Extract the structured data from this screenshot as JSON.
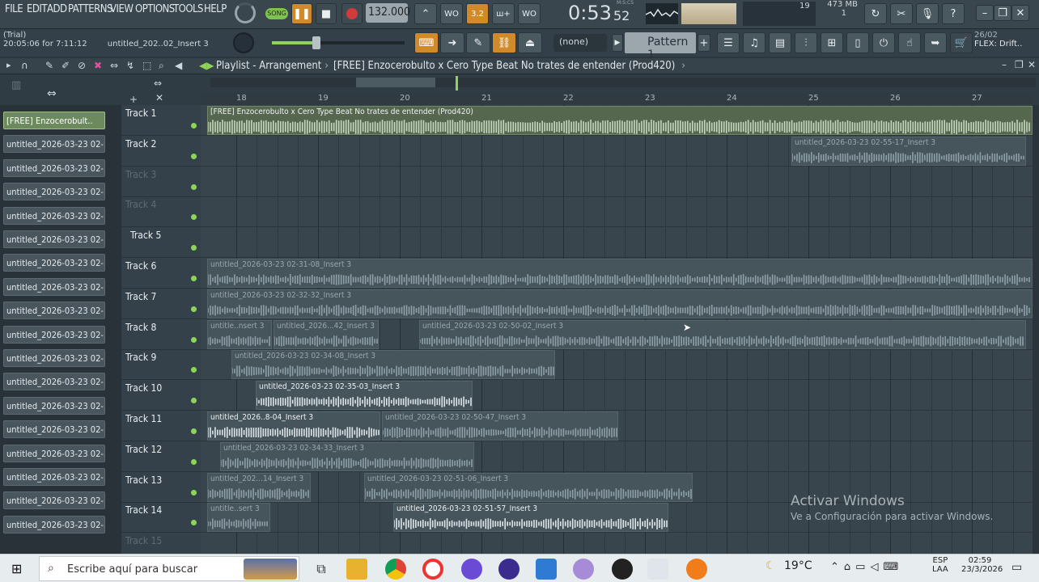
{
  "menu": [
    "FILE",
    "EDIT",
    "ADD",
    "PATTERNS",
    "VIEW",
    "OPTIONS",
    "TOOLS",
    "HELP"
  ],
  "transport": {
    "mode": "SONG",
    "tempo": "132.000",
    "time": "0:53",
    "time_sub": "52",
    "time_unit": "M:S:CS",
    "cpu": "19",
    "memory": "473 MB",
    "voices": "1"
  },
  "info": {
    "status": "(Trial)",
    "trial_time": "20:05:06 for 7:11:12",
    "hint": "untitled_202..02_Insert 3",
    "snap": "(none)",
    "pattern": "Pattern 1",
    "news_date": "26/02",
    "news_text": "FLEX: Drift.."
  },
  "playlist": {
    "breadcrumb": "Playlist - Arrangement",
    "separator": "›",
    "project": "[FREE] Enzocerobulto x Cero  Type Beat  No trates de entender  (Prod420)"
  },
  "ruler": [
    "18",
    "19",
    "20",
    "21",
    "22",
    "23",
    "24",
    "25",
    "26",
    "27"
  ],
  "patterns": [
    "[FREE] Enzocerobult..",
    "untitled_2026-03-23 02-..",
    "untitled_2026-03-23 02-..",
    "untitled_2026-03-23 02-..",
    "untitled_2026-03-23 02-..",
    "untitled_2026-03-23 02-..",
    "untitled_2026-03-23 02-..",
    "untitled_2026-03-23 02-..",
    "untitled_2026-03-23 02-..",
    "untitled_2026-03-23 02-..",
    "untitled_2026-03-23 02-..",
    "untitled_2026-03-23 02-..",
    "untitled_2026-03-23 02-..",
    "untitled_2026-03-23 02-..",
    "untitled_2026-03-23 02-..",
    "untitled_2026-03-23 02-..",
    "untitled_2026-03-23 02-..",
    "untitled_2026-03-23 02-.."
  ],
  "tracks": [
    "Track 1",
    "Track 2",
    "Track 3",
    "Track 4",
    "Track 5",
    "Track 6",
    "Track 7",
    "Track 8",
    "Track 9",
    "Track 10",
    "Track 11",
    "Track 12",
    "Track 13",
    "Track 14",
    "Track 15"
  ],
  "clips": {
    "t1": "[FREE] Enzocerobulto x Cero  Type Beat  No trates de entender  (Prod420)",
    "t2": "untitled_2026-03-23 02-55-17_Insert 3",
    "t6": "untitled_2026-03-23 02-31-08_Insert 3",
    "t7": "untitled_2026-03-23 02-32-32_Insert 3",
    "t8a": "untitle..nsert 3",
    "t8b": "untitled_2026...42_Insert 3",
    "t8c": "untitled_2026-03-23 02-50-02_Insert 3",
    "t9": "untitled_2026-03-23 02-34-08_Insert 3",
    "t10": "untitled_2026-03-23 02-35-03_Insert 3",
    "t11a": "untitled_2026..8-04_Insert 3",
    "t11b": "untitled_2026-03-23 02-50-47_Insert 3",
    "t12": "untitled_2026-03-23 02-34-33_Insert 3",
    "t13a": "untitled_202...14_Insert 3",
    "t13b": "untitled_2026-03-23 02-51-06_Insert 3",
    "t14a": "untitle..sert 3",
    "t14b": "untitled_2026-03-23 02-51-57_Insert 3"
  },
  "watermark": {
    "title": "Activar Windows",
    "subtitle": "Ve a Configuración para activar Windows."
  },
  "taskbar": {
    "search_placeholder": "Escribe aquí para buscar",
    "temperature": "19°C",
    "lang": "ESP",
    "lang_sub": "LAA",
    "clock_time": "02:59",
    "clock_date": "23/3/2026"
  }
}
